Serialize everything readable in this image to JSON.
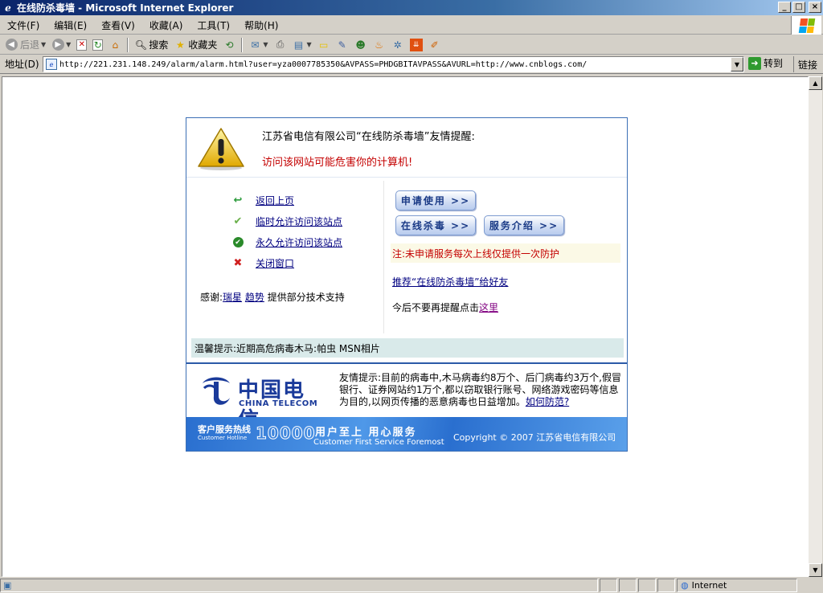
{
  "window": {
    "title": "在线防杀毒墙 - Microsoft Internet Explorer"
  },
  "menu": [
    "文件(F)",
    "编辑(E)",
    "查看(V)",
    "收藏(A)",
    "工具(T)",
    "帮助(H)"
  ],
  "toolbar": {
    "back_label": "后退",
    "search_label": "搜索",
    "favorites_label": "收藏夹"
  },
  "address": {
    "label": "地址(D)",
    "url": "http://221.231.148.249/alarm/alarm.html?user=yza0007785350&AVPASS=PHDGBITAVPASS&AVURL=http://www.cnblogs.com/",
    "go_label": "转到",
    "links_label": "链接"
  },
  "alert": {
    "title": "江苏省电信有限公司“在线防杀毒墙”友情提醒:",
    "warning": "访问该网站可能危害你的计算机!",
    "options": {
      "back": "返回上页",
      "temp_allow": "临时允许访问该站点",
      "perm_allow": "永久允许访问该站点",
      "close": "关闭窗口"
    },
    "thanks_prefix": "感谢:",
    "thanks_rising": "瑞星",
    "thanks_trend": "趋势",
    "thanks_suffix": "提供部分技术支持",
    "buttons": {
      "apply": "申请使用 >>",
      "scan": "在线杀毒 >>",
      "intro": "服务介绍 >>"
    },
    "note": "注:未申请服务每次上线仅提供一次防护",
    "recommend": "推荐“在线防杀毒墙”给好友",
    "no_remind_prefix": "今后不要再提醒点击",
    "no_remind_link": "这里",
    "tip": "温馨提示:近期高危病毒木马:帕虫  MSN相片"
  },
  "telecom": {
    "logo_cn": "中国电信",
    "logo_en": "CHINA TELECOM",
    "friendly_text": "友情提示:目前的病毒中,木马病毒约8万个、后门病毒约3万个,假冒银行、证券网站约1万个,都以窃取银行账号、网络游戏密码等信息为目的,以网页传播的恶意病毒也日益增加。",
    "friendly_link": "如何防范?"
  },
  "footer": {
    "hotline_cn": "客户服务热线",
    "hotline_en": "Customer Hotline",
    "hotline_number": "10000",
    "slogan_cn": "用户至上 用心服务",
    "slogan_en": "Customer First Service Foremost",
    "copyright": "Copyright © 2007 江苏省电信有限公司"
  },
  "status": {
    "zone": "Internet"
  }
}
